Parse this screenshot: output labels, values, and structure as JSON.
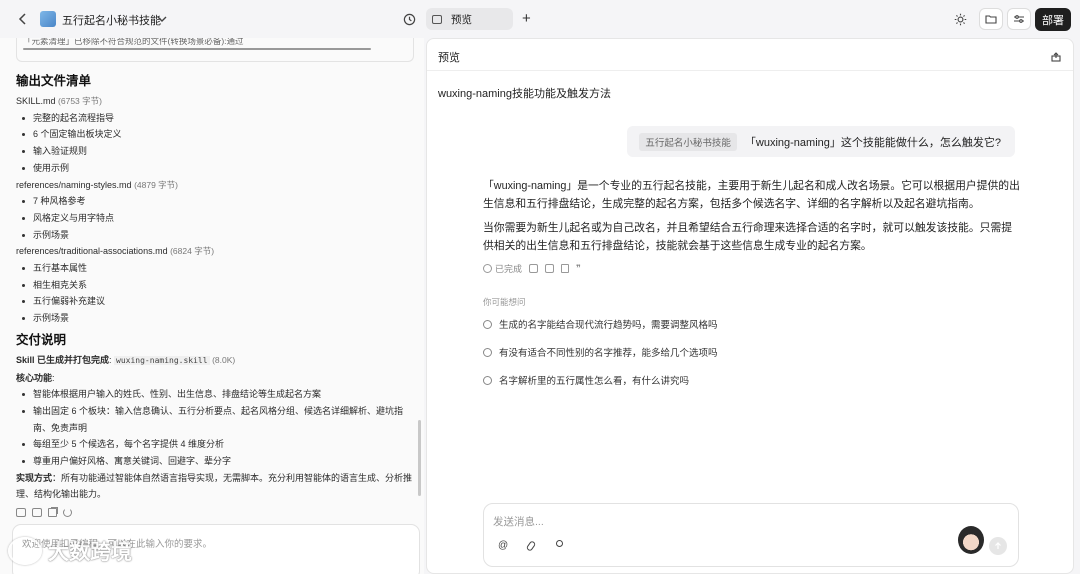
{
  "topbar": {
    "title": "五行起名小秘书技能",
    "tab_label": "预览",
    "add_tab": "+",
    "deploy_label": "部署"
  },
  "left": {
    "partial_line": "「元素清理」已移除不符合规范的文件(转换场景必备):通过",
    "section1_title": "输出文件清单",
    "files": [
      {
        "name": "SKILL.md",
        "size": "(6753 字节)",
        "items": [
          "完整的起名流程指导",
          "6 个固定输出板块定义",
          "输入验证规则",
          "使用示例"
        ]
      },
      {
        "name": "references/naming-styles.md",
        "size": "(4879 字节)",
        "items": [
          "7 种风格参考",
          "风格定义与用字特点",
          "示例场景"
        ]
      },
      {
        "name": "references/traditional-associations.md",
        "size": "(6824 字节)",
        "items": [
          "五行基本属性",
          "相生相克关系",
          "五行偏弱补充建议",
          "示例场景"
        ]
      }
    ],
    "section2_title": "交付说明",
    "skill_label": "Skill 已生成并打包完成",
    "skill_code": "wuxing-naming.skill",
    "skill_size": "(8.0K)",
    "core_label": "核心功能",
    "core_items": [
      "智能体根据用户输入的姓氏、性别、出生信息、排盘结论等生成起名方案",
      "输出固定 6 个板块：输入信息确认、五行分析要点、起名风格分组、候选名详细解析、避坑指南、免责声明",
      "每组至少 5 个候选名，每个名字提供 4 维度分析",
      "尊重用户偏好风格、寓意关键词、回避字、辈分字"
    ],
    "impl_label": "实现方式",
    "impl_text": "所有功能通过智能体自然语言指导实现，无需脚本。充分利用智能体的语言生成、分析推理、结构化输出能力。",
    "input_placeholder": "欢迎使用扣子编程，可以在此输入你的要求。",
    "watermark": "大数跨境"
  },
  "right": {
    "header_title": "预览",
    "conv_title": "wuxing-naming技能功能及触发方法",
    "question_chip": "五行起名小秘书技能",
    "question_text": "「wuxing-naming」这个技能能做什么，怎么触发它?",
    "answer_p1": "「wuxing-naming」是一个专业的五行起名技能，主要用于新生儿起名和成人改名场景。它可以根据用户提供的出生信息和五行排盘结论，生成完整的起名方案，包括多个候选名字、详细的名字解析以及起名避坑指南。",
    "answer_p2": "当你需要为新生儿起名或为自己改名，并且希望结合五行命理来选择合适的名字时，就可以触发该技能。只需提供相关的出生信息和五行排盘结论，技能就会基于这些信息生成专业的起名方案。",
    "status": "已完成",
    "suggest_label": "你可能想问",
    "suggestions": [
      "生成的名字能结合现代流行趋势吗，需要调整风格吗",
      "有没有适合不同性别的名字推荐，能多给几个选项吗",
      "名字解析里的五行属性怎么看，有什么讲究吗"
    ],
    "input_placeholder": "发送消息..."
  },
  "colors": {
    "accent": "#1f1f1f",
    "deploy_bg": "#1f1f1f"
  }
}
